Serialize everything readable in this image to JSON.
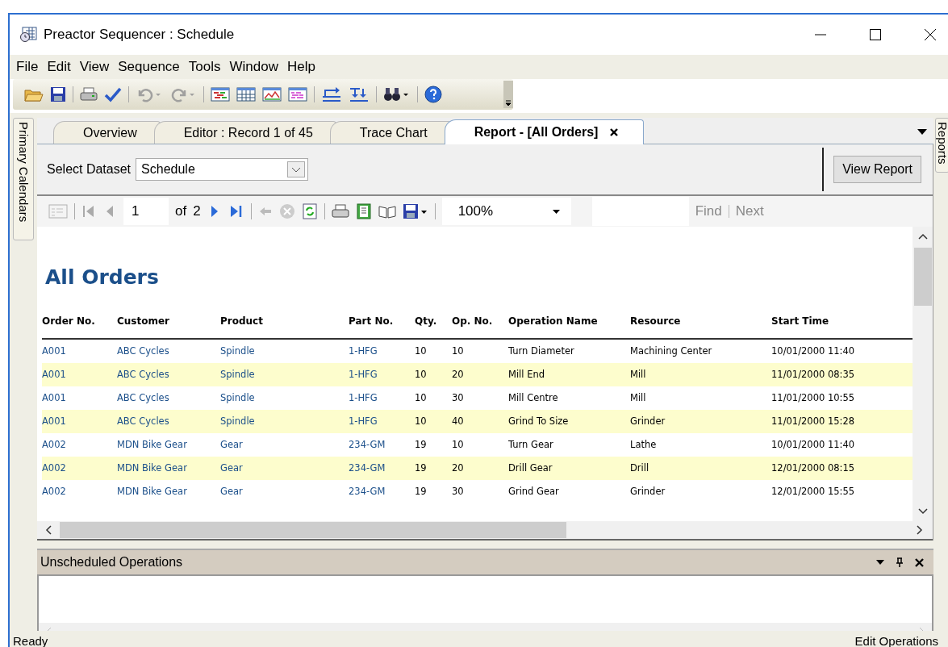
{
  "window": {
    "title": "Preactor Sequencer : Schedule"
  },
  "menu": [
    "File",
    "Edit",
    "View",
    "Sequence",
    "Tools",
    "Window",
    "Help"
  ],
  "left_dock_tabs": [
    "Primary Calendars"
  ],
  "right_dock_tabs": [
    "Reports"
  ],
  "tabs": [
    {
      "label": "Overview",
      "selected": false
    },
    {
      "label": "Editor : Record 1 of 45",
      "selected": false
    },
    {
      "label": "Trace Chart",
      "selected": false
    },
    {
      "label": "Report - [All Orders]",
      "selected": true
    }
  ],
  "dataset": {
    "label": "Select Dataset",
    "value": "Schedule"
  },
  "view_report_button": "View Report",
  "report_toolbar": {
    "page": "1",
    "of": "of",
    "total": "2",
    "zoom": "100%",
    "find": {
      "label": "Find",
      "disabled": true
    },
    "next": {
      "label": "Next",
      "disabled": true
    }
  },
  "report": {
    "title": "All Orders",
    "columns": [
      {
        "label": "Order No.",
        "kind": "link"
      },
      {
        "label": "Customer",
        "kind": "link"
      },
      {
        "label": "Product",
        "kind": "link"
      },
      {
        "label": "Part No.",
        "kind": "link"
      },
      {
        "label": "Qty.",
        "kind": "text"
      },
      {
        "label": "Op. No.",
        "kind": "text"
      },
      {
        "label": "Operation Name",
        "kind": "text"
      },
      {
        "label": "Resource",
        "kind": "text"
      },
      {
        "label": "Start Time",
        "kind": "text"
      }
    ],
    "rows": [
      [
        "A001",
        "ABC Cycles",
        "Spindle",
        "1-HFG",
        "10",
        "10",
        "Turn Diameter",
        "Machining Center",
        "10/01/2000 11:40"
      ],
      [
        "A001",
        "ABC Cycles",
        "Spindle",
        "1-HFG",
        "10",
        "20",
        "Mill End",
        "Mill",
        "11/01/2000 08:35"
      ],
      [
        "A001",
        "ABC Cycles",
        "Spindle",
        "1-HFG",
        "10",
        "30",
        "Mill Centre",
        "Mill",
        "11/01/2000 10:55"
      ],
      [
        "A001",
        "ABC Cycles",
        "Spindle",
        "1-HFG",
        "10",
        "40",
        "Grind To Size",
        "Grinder",
        "11/01/2000 15:28"
      ],
      [
        "A002",
        "MDN Bike Gear",
        "Gear",
        "234-GM",
        "19",
        "10",
        "Turn Gear",
        "Lathe",
        "10/01/2000 11:40"
      ],
      [
        "A002",
        "MDN Bike Gear",
        "Gear",
        "234-GM",
        "19",
        "20",
        "Drill Gear",
        "Drill",
        "12/01/2000 08:15"
      ],
      [
        "A002",
        "MDN Bike Gear",
        "Gear",
        "234-GM",
        "19",
        "30",
        "Grind Gear",
        "Grinder",
        "12/01/2000 15:55"
      ]
    ]
  },
  "unscheduled_panel": {
    "title": "Unscheduled Operations"
  },
  "status_bar": {
    "left": "Ready",
    "right": "Edit Operations"
  }
}
